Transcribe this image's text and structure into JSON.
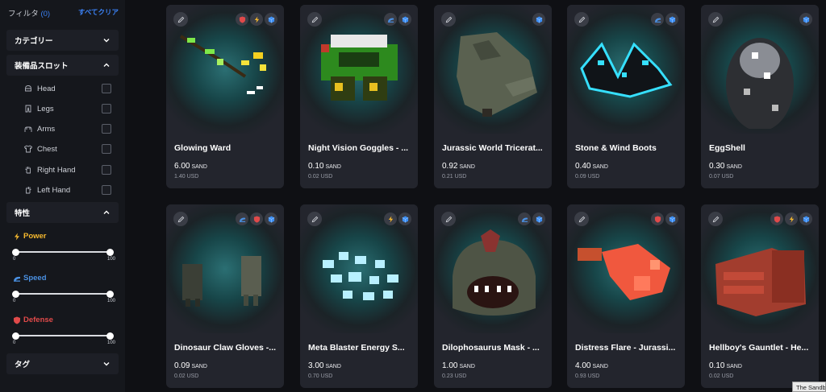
{
  "filter": {
    "title": "フィルタ",
    "count": "(0)",
    "clear_all": "すべてクリア"
  },
  "sections": {
    "category": "カテゴリー",
    "slots": "装備品スロット",
    "traits": "特性",
    "tags": "タグ"
  },
  "slots": [
    {
      "label": "Head",
      "icon": "head-icon"
    },
    {
      "label": "Legs",
      "icon": "legs-icon"
    },
    {
      "label": "Arms",
      "icon": "arms-icon"
    },
    {
      "label": "Chest",
      "icon": "chest-icon"
    },
    {
      "label": "Right Hand",
      "icon": "right-hand-icon"
    },
    {
      "label": "Left Hand",
      "icon": "left-hand-icon"
    }
  ],
  "traits": [
    {
      "label": "Power",
      "color": "#f5b82e",
      "min": "0",
      "max": "100",
      "low": 0,
      "high": 100
    },
    {
      "label": "Speed",
      "color": "#4a90e2",
      "min": "0",
      "max": "100",
      "low": 0,
      "high": 100
    },
    {
      "label": "Defense",
      "color": "#e04a4a",
      "min": "0",
      "max": "100",
      "low": 0,
      "high": 100
    }
  ],
  "currency": "SAND",
  "cards": [
    {
      "name": "Glowing Ward",
      "price": "6.00",
      "usd": "1.40 USD",
      "badges": [
        "defense-icon",
        "power-icon",
        "cube-icon"
      ]
    },
    {
      "name": "Night Vision Goggles - ...",
      "price": "0.10",
      "usd": "0.02 USD",
      "badges": [
        "speed-icon",
        "cube-icon"
      ]
    },
    {
      "name": "Jurassic World Tricerat...",
      "price": "0.92",
      "usd": "0.21 USD",
      "badges": [
        "cube-icon"
      ]
    },
    {
      "name": "Stone & Wind Boots",
      "price": "0.40",
      "usd": "0.09 USD",
      "badges": [
        "speed-icon",
        "cube-icon"
      ]
    },
    {
      "name": "EggShell",
      "price": "0.30",
      "usd": "0.07 USD",
      "badges": [
        "cube-icon"
      ]
    },
    {
      "name": "Dinosaur Claw Gloves -...",
      "price": "0.09",
      "usd": "0.02 USD",
      "badges": [
        "speed-icon",
        "defense-icon",
        "cube-icon"
      ]
    },
    {
      "name": "Meta Blaster Energy S...",
      "price": "3.00",
      "usd": "0.70 USD",
      "badges": [
        "power-icon",
        "cube-icon"
      ]
    },
    {
      "name": "Dilophosaurus Mask - ...",
      "price": "1.00",
      "usd": "0.23 USD",
      "badges": [
        "speed-icon",
        "cube-icon"
      ]
    },
    {
      "name": "Distress Flare - Jurassi...",
      "price": "4.00",
      "usd": "0.93 USD",
      "badges": [
        "defense-icon",
        "cube-icon"
      ]
    },
    {
      "name": "Hellboy's Gauntlet - He...",
      "price": "0.10",
      "usd": "0.02 USD",
      "badges": [
        "defense-icon",
        "power-icon",
        "cube-icon"
      ]
    }
  ],
  "tooltip": "The Sandbox"
}
